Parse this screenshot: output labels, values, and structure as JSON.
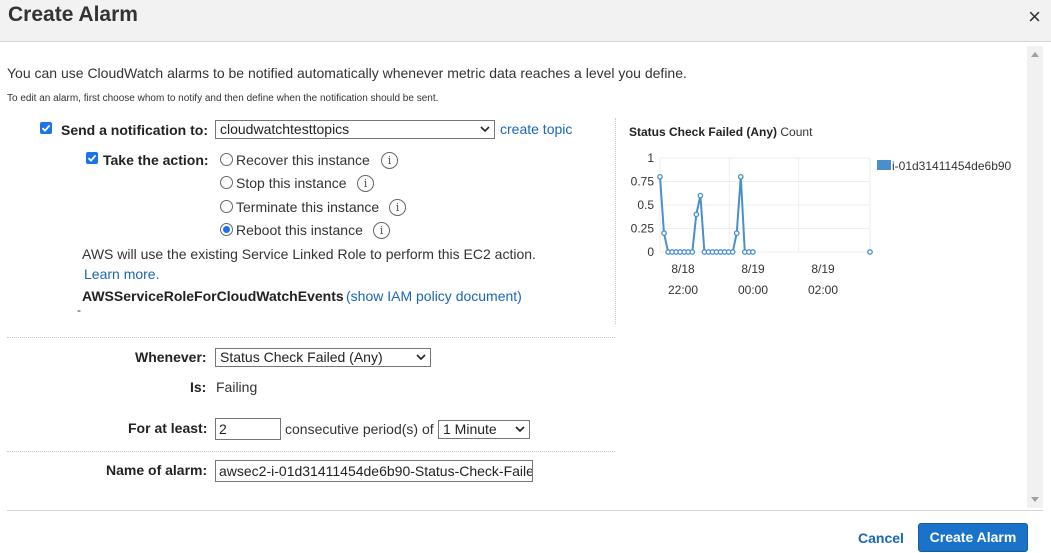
{
  "dialog": {
    "title": "Create Alarm",
    "close": "×"
  },
  "intro": "You can use CloudWatch alarms to be notified automatically whenever metric data reaches a level you define.",
  "small_note": "To edit an alarm, first choose whom to notify and then define when the notification should be sent.",
  "notification": {
    "label": "Send a notification to:",
    "checked": true,
    "topic": "cloudwatchtesttopics",
    "create_topic": "create topic"
  },
  "action": {
    "label": "Take the action:",
    "checked": true,
    "options": [
      {
        "label": "Recover this instance",
        "selected": false
      },
      {
        "label": "Stop this instance",
        "selected": false
      },
      {
        "label": "Terminate this instance",
        "selected": false
      },
      {
        "label": "Reboot this instance",
        "selected": true
      }
    ],
    "role_note": "AWS will use the existing Service Linked Role to perform this EC2 action.",
    "learn_more": "Learn more.",
    "role_name": "AWSServiceRoleForCloudWatchEvents",
    "show_policy": "(show IAM policy document)",
    "dash": "-"
  },
  "whenever": {
    "label": "Whenever:",
    "value": "Status Check Failed (Any)"
  },
  "is": {
    "label": "Is:",
    "value": "Failing"
  },
  "for_at_least": {
    "label": "For at least:",
    "value": "2",
    "mid_text": "consecutive period(s) of",
    "period": "1 Minute"
  },
  "alarm_name": {
    "label": "Name of alarm:",
    "value": "awsec2-i-01d31411454de6b90-Status-Check-Faile"
  },
  "buttons": {
    "cancel": "Cancel",
    "create": "Create Alarm"
  },
  "colors": {
    "accent": "#1a73c9",
    "series": "#4a8fcc"
  },
  "chart_data": {
    "type": "line",
    "title": "Status Check Failed (Any)",
    "unit": "Count",
    "ylim": [
      0,
      1
    ],
    "yticks": [
      "1",
      "0.75",
      "0.5",
      "0.25",
      "0"
    ],
    "xticks": [
      {
        "date": "8/18",
        "time": "22:00"
      },
      {
        "date": "8/19",
        "time": "00:00"
      },
      {
        "date": "8/19",
        "time": "02:00"
      }
    ],
    "series": [
      {
        "name": "i-01d31411454de6b90",
        "points": [
          [
            0,
            0.8
          ],
          [
            1,
            0.2
          ],
          [
            2,
            0
          ],
          [
            3,
            0
          ],
          [
            4,
            0
          ],
          [
            5,
            0
          ],
          [
            6,
            0
          ],
          [
            7,
            0
          ],
          [
            8,
            0
          ],
          [
            9,
            0.4
          ],
          [
            10,
            0.6
          ],
          [
            11,
            0
          ],
          [
            12,
            0
          ],
          [
            13,
            0
          ],
          [
            14,
            0
          ],
          [
            15,
            0
          ],
          [
            16,
            0
          ],
          [
            17,
            0
          ],
          [
            18,
            0
          ],
          [
            19,
            0.2
          ],
          [
            20,
            0.8
          ],
          [
            21,
            0
          ],
          [
            22,
            0
          ],
          [
            23,
            0
          ],
          [
            52,
            0
          ]
        ]
      }
    ],
    "grid": true,
    "legend": "top-right"
  }
}
